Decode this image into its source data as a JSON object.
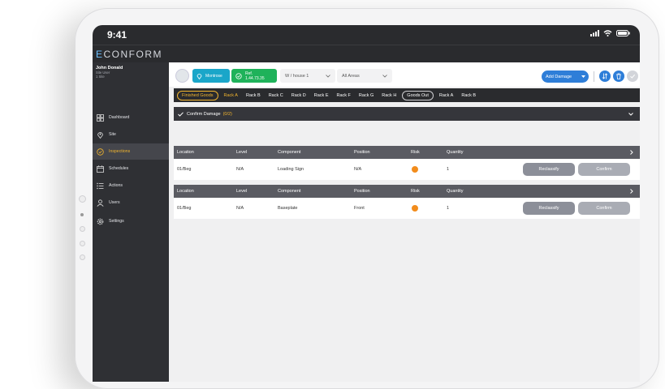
{
  "status": {
    "time": "9:41"
  },
  "app": {
    "logo_mark": "E",
    "logo_text": "CONFORM"
  },
  "user": {
    "name": "John Donald",
    "role": "Site User",
    "sites": "1 Site"
  },
  "nav": [
    {
      "label": "Dashboard",
      "icon": "dashboard-icon",
      "active": false
    },
    {
      "label": "Site",
      "icon": "location-pin-icon",
      "active": false
    },
    {
      "label": "Inspections",
      "icon": "inspection-check-icon",
      "active": true
    },
    {
      "label": "Schedules",
      "icon": "calendar-icon",
      "active": false
    },
    {
      "label": "Actions",
      "icon": "list-icon",
      "active": false
    },
    {
      "label": "Users",
      "icon": "user-icon",
      "active": false
    },
    {
      "label": "Settings",
      "icon": "gear-icon",
      "active": false
    }
  ],
  "toolbar": {
    "site_label": "Montrose",
    "ref_label": "Ref. 1.44.73.35",
    "warehouse_select": "W / house 1",
    "area_select": "All Areas",
    "add_damage_label": "Add Damage"
  },
  "tabs": [
    {
      "label": "Finished Goods",
      "group": true,
      "active": true
    },
    {
      "label": "Rack A",
      "group": false,
      "active": true
    },
    {
      "label": "Rack B",
      "group": false,
      "active": false
    },
    {
      "label": "Rack C",
      "group": false,
      "active": false
    },
    {
      "label": "Rack D",
      "group": false,
      "active": false
    },
    {
      "label": "Rack E",
      "group": false,
      "active": false
    },
    {
      "label": "Rack F",
      "group": false,
      "active": false
    },
    {
      "label": "Rack G",
      "group": false,
      "active": false
    },
    {
      "label": "Rack H",
      "group": false,
      "active": false
    },
    {
      "label": "Goods Out",
      "group": true,
      "active": false
    },
    {
      "label": "Rack A",
      "group": false,
      "active": false
    },
    {
      "label": "Rack B",
      "group": false,
      "active": false
    }
  ],
  "confirm": {
    "label": "Confirm Damage",
    "count": "(0/2)"
  },
  "table": {
    "headers": [
      "Location",
      "Level",
      "Component",
      "Position",
      "Risk",
      "Quantity"
    ],
    "rows": [
      {
        "location": "01/Beg",
        "level": "N/A",
        "component": "Loading Sign",
        "position": "N/A",
        "risk_color": "#f28c1c",
        "quantity": "1"
      },
      {
        "location": "01/Beg",
        "level": "N/A",
        "component": "Baseplate",
        "position": "Front",
        "risk_color": "#f28c1c",
        "quantity": "1"
      }
    ],
    "reclassify_label": "Reclassify",
    "confirm_label": "Confirm"
  },
  "colors": {
    "accent": "#2e7ed8",
    "active": "#f2b52e",
    "risk": "#f28c1c",
    "green": "#1fb25a",
    "teal": "#1aa6c9"
  }
}
